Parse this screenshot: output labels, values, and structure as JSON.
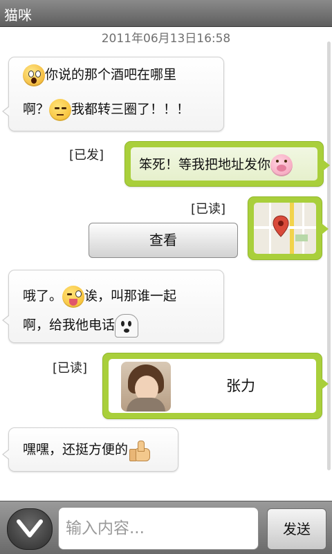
{
  "app": {
    "title": "猫咪"
  },
  "timestamp": "2011年06月13日16:58",
  "messages": [
    {
      "direction": "in",
      "line1": "你说的那个酒吧在哪里",
      "line2_a": "啊？",
      "line2_b": "我都转三圈了！！！",
      "emoji_start": "scream-emoji-icon",
      "emoji_mid": "unamused-emoji-icon"
    },
    {
      "direction": "out",
      "status": "[已发]",
      "text": "笨死！等我把地址发你",
      "emoji_end": "pig-emoji-icon"
    },
    {
      "direction": "out",
      "status": "[已读]",
      "type": "map",
      "button_label": "查看",
      "icon": "map-pin-icon"
    },
    {
      "direction": "in",
      "line1_a": "哦了。",
      "line1_b": "诶，叫那谁一起",
      "line2": "啊，给我他电话",
      "emoji_mid": "winking-tongue-emoji-icon",
      "emoji_end": "ghost-emoji-icon"
    },
    {
      "direction": "out",
      "status": "[已读]",
      "type": "contact",
      "contact_name": "张力",
      "avatar": "contact-avatar"
    },
    {
      "direction": "in",
      "text": "嘿嘿，还挺方便的",
      "emoji_end": "thumbs-up-emoji-icon"
    }
  ],
  "composer": {
    "placeholder": "输入内容...",
    "send_label": "发送",
    "collapse_icon": "chevron-down-icon"
  },
  "colors": {
    "titlebar": "#6f6f6f",
    "outgoing_bubble": "#a9cf3b",
    "incoming_bubble": "#f7f7f7"
  }
}
